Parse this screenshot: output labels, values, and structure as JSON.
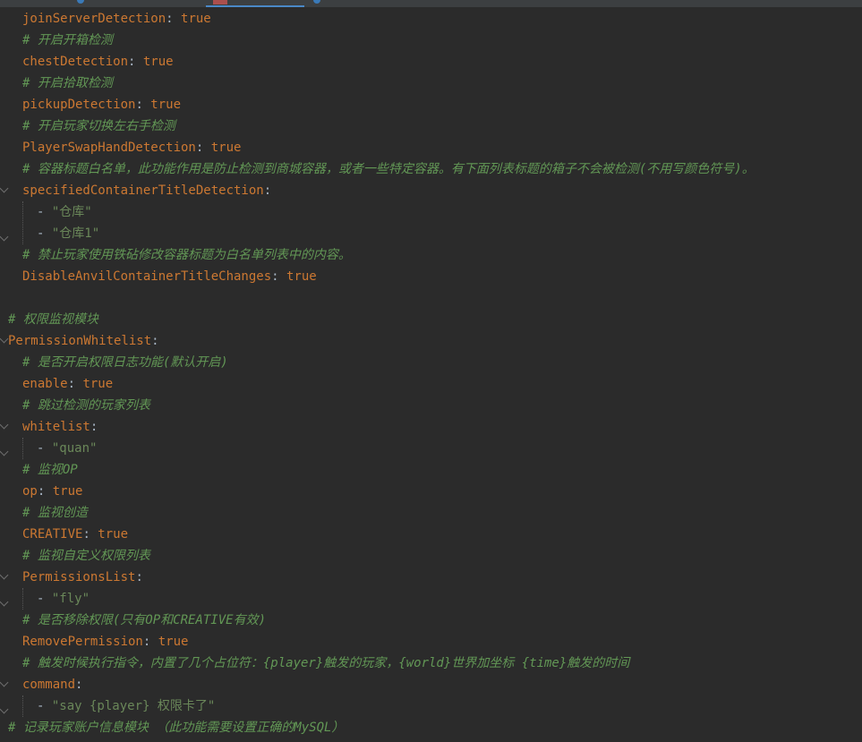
{
  "editor": {
    "lines": [
      {
        "indent": 1,
        "type": "kv",
        "key": "joinServerDetection",
        "value": "true"
      },
      {
        "indent": 1,
        "type": "comment",
        "text": "# 开启开箱检测"
      },
      {
        "indent": 1,
        "type": "kv",
        "key": "chestDetection",
        "value": "true"
      },
      {
        "indent": 1,
        "type": "comment",
        "text": "# 开启拾取检测"
      },
      {
        "indent": 1,
        "type": "kv",
        "key": "pickupDetection",
        "value": "true"
      },
      {
        "indent": 1,
        "type": "comment",
        "text": "# 开启玩家切换左右手检测"
      },
      {
        "indent": 1,
        "type": "kv",
        "key": "PlayerSwapHandDetection",
        "value": "true"
      },
      {
        "indent": 1,
        "type": "comment",
        "text": "# 容器标题白名单，此功能作用是防止检测到商城容器，或者一些特定容器。有下面列表标题的箱子不会被检测(不用写颜色符号)。"
      },
      {
        "indent": 1,
        "type": "key",
        "key": "specifiedContainerTitleDetection"
      },
      {
        "indent": 2,
        "type": "item",
        "value": "\"仓库\""
      },
      {
        "indent": 2,
        "type": "item",
        "value": "\"仓库1\""
      },
      {
        "indent": 1,
        "type": "comment",
        "text": "# 禁止玩家使用铁砧修改容器标题为白名单列表中的内容。"
      },
      {
        "indent": 1,
        "type": "kv",
        "key": "DisableAnvilContainerTitleChanges",
        "value": "true"
      },
      {
        "indent": 0,
        "type": "blank"
      },
      {
        "indent": 0,
        "type": "comment",
        "text": "# 权限监视模块"
      },
      {
        "indent": 0,
        "type": "key",
        "key": "PermissionWhitelist"
      },
      {
        "indent": 1,
        "type": "comment",
        "text": "# 是否开启权限日志功能(默认开启)"
      },
      {
        "indent": 1,
        "type": "kv",
        "key": "enable",
        "value": "true"
      },
      {
        "indent": 1,
        "type": "comment",
        "text": "# 跳过检测的玩家列表"
      },
      {
        "indent": 1,
        "type": "key",
        "key": "whitelist"
      },
      {
        "indent": 2,
        "type": "item",
        "value": "\"quan\""
      },
      {
        "indent": 1,
        "type": "comment",
        "text": "# 监视OP"
      },
      {
        "indent": 1,
        "type": "kv",
        "key": "op",
        "value": "true"
      },
      {
        "indent": 1,
        "type": "comment",
        "text": "# 监视创造"
      },
      {
        "indent": 1,
        "type": "kv",
        "key": "CREATIVE",
        "value": "true"
      },
      {
        "indent": 1,
        "type": "comment",
        "text": "# 监视自定义权限列表"
      },
      {
        "indent": 1,
        "type": "key",
        "key": "PermissionsList"
      },
      {
        "indent": 2,
        "type": "item",
        "value": "\"fly\""
      },
      {
        "indent": 1,
        "type": "comment",
        "text": "# 是否移除权限(只有OP和CREATIVE有效)"
      },
      {
        "indent": 1,
        "type": "kv",
        "key": "RemovePermission",
        "value": "true"
      },
      {
        "indent": 1,
        "type": "comment",
        "text": "# 触发时候执行指令，内置了几个占位符：{player}触发的玩家，{world}世界加坐标 {time}触发的时间"
      },
      {
        "indent": 1,
        "type": "key",
        "key": "command"
      },
      {
        "indent": 2,
        "type": "item",
        "value": "\"say {player} 权限卡了\""
      },
      {
        "indent": 0,
        "type": "comment",
        "text": "# 记录玩家账户信息模块 （此功能需要设置正确的MySQL）"
      }
    ]
  }
}
